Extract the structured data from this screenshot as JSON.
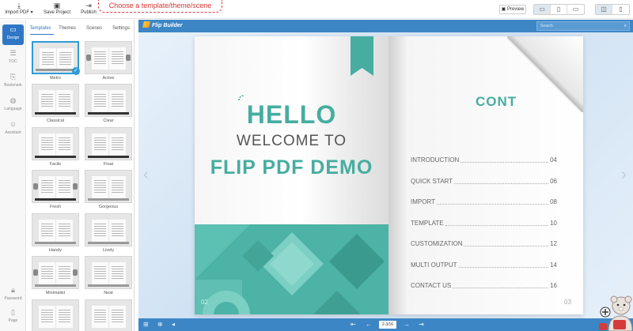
{
  "toolbar": {
    "import_label": "Import PDF",
    "save_label": "Save Project",
    "publish_label": "Publish",
    "callout": "Choose a template/theme/scene",
    "preview_label": "Preview"
  },
  "rail": {
    "items": [
      {
        "label": "Design"
      },
      {
        "label": "TOC"
      },
      {
        "label": "Bookmark"
      },
      {
        "label": "Language"
      },
      {
        "label": "Assistant"
      },
      {
        "label": "Password"
      },
      {
        "label": "Page"
      }
    ]
  },
  "panel": {
    "tabs": [
      "Templates",
      "Themes",
      "Scenes",
      "Settings"
    ],
    "templates": [
      "Metro",
      "Active",
      "Classical",
      "Clear",
      "Facile",
      "Float",
      "Fresh",
      "Gorgeous",
      "Handy",
      "Lively",
      "Minimalist",
      "Neat"
    ]
  },
  "viewer": {
    "brand": "Flip Builder",
    "search_placeholder": "Search",
    "page_indicator": "2-3/16"
  },
  "book": {
    "left": {
      "hello": "HELLO",
      "welcome": "WELCOME TO",
      "demo": "FLIP PDF DEMO",
      "page_number": "02"
    },
    "right": {
      "contents_visible": "CONT",
      "toc": [
        {
          "title": "INTRODUCTION",
          "page": "04"
        },
        {
          "title": "QUICK START",
          "page": "06"
        },
        {
          "title": "IMPORT",
          "page": "08"
        },
        {
          "title": "TEMPLATE",
          "page": "10"
        },
        {
          "title": "CUSTOMIZATION",
          "page": "12"
        },
        {
          "title": "MULTI OUTPUT",
          "page": "14"
        },
        {
          "title": "CONTACT US",
          "page": "16"
        }
      ],
      "page_number": "03"
    }
  },
  "colors": {
    "accent": "#46ada0",
    "viewer_bar": "#3d86c6",
    "selected": "#2f9bd8",
    "design_active": "#2f77c5",
    "callout": "#d83434"
  },
  "icons": {
    "import": "import-icon",
    "save": "save-icon",
    "publish": "publish-icon"
  }
}
